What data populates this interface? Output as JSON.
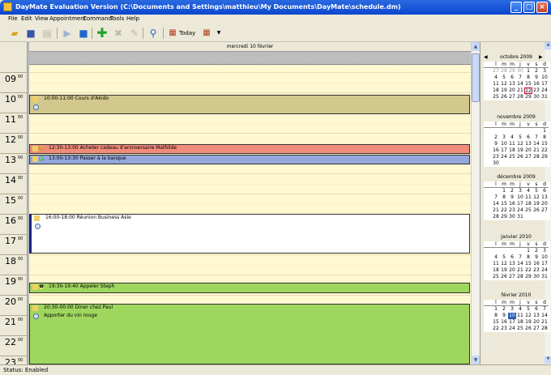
{
  "window": {
    "title": "DayMate Evaluation Version (C:\\Documents and Settings\\matthieu\\My Documents\\DayMate\\schedule.dm)"
  },
  "menu": [
    "File",
    "Edit",
    "View",
    "Appointment",
    "Command",
    "Tools",
    "Help"
  ],
  "toolbar": {
    "today_label": "Today"
  },
  "dayview": {
    "header": "mercredi 10 février",
    "hours": [
      {
        "h": "09",
        "m": "00"
      },
      {
        "h": "10",
        "m": "00"
      },
      {
        "h": "11",
        "m": "00"
      },
      {
        "h": "12",
        "m": "00"
      },
      {
        "h": "13",
        "m": "00"
      },
      {
        "h": "14",
        "m": "00"
      },
      {
        "h": "15",
        "m": "00"
      },
      {
        "h": "16",
        "m": "00"
      },
      {
        "h": "17",
        "m": "00"
      },
      {
        "h": "18",
        "m": "00"
      },
      {
        "h": "19",
        "m": "00"
      },
      {
        "h": "20",
        "m": "00"
      },
      {
        "h": "21",
        "m": "00"
      },
      {
        "h": "22",
        "m": "00"
      },
      {
        "h": "23",
        "m": "00"
      }
    ],
    "appointments": [
      {
        "text": "10:00-11:00 Cours d'Akido",
        "color": "#d2c88e"
      },
      {
        "text": "12:30-13:00 Acheter cadeau d'anniversaire Mathilde",
        "color": "#f28c7a"
      },
      {
        "text": "13:00-13:30 Passer à la banque",
        "color": "#93a6dd"
      },
      {
        "text": "16:00-18:00 Réunion Business Asie",
        "color": "#ffffff"
      },
      {
        "text": "19:30-19:40 Appeler Steph",
        "color": "#9fd65e"
      },
      {
        "text": "20:30-00:00 Diner chez Paul",
        "note": "Apporter du vin rouge",
        "color": "#9fd65e"
      }
    ]
  },
  "calendars": [
    {
      "month": "octobre 2009",
      "days": [
        "l",
        "m",
        "m",
        "j",
        "v",
        "s",
        "d"
      ],
      "weeks": [
        [
          "27",
          "28",
          "29",
          "30",
          "1",
          "2",
          "3"
        ],
        [
          "4",
          "5",
          "6",
          "7",
          "8",
          "9",
          "10"
        ],
        [
          "11",
          "12",
          "13",
          "14",
          "15",
          "16",
          "17"
        ],
        [
          "18",
          "19",
          "20",
          "21",
          "22",
          "23",
          "24"
        ],
        [
          "25",
          "26",
          "27",
          "28",
          "29",
          "30",
          "31"
        ]
      ]
    },
    {
      "month": "novembre 2009",
      "days": [
        "l",
        "m",
        "m",
        "j",
        "v",
        "s",
        "d"
      ],
      "weeks": [
        [
          "",
          "",
          "",
          "",
          "",
          "",
          "1"
        ],
        [
          "2",
          "3",
          "4",
          "5",
          "6",
          "7",
          "8"
        ],
        [
          "9",
          "10",
          "11",
          "12",
          "13",
          "14",
          "15"
        ],
        [
          "16",
          "17",
          "18",
          "19",
          "20",
          "21",
          "22"
        ],
        [
          "23",
          "24",
          "25",
          "26",
          "27",
          "28",
          "29"
        ],
        [
          "30",
          "",
          "",
          "",
          "",
          "",
          ""
        ]
      ]
    },
    {
      "month": "décembre 2009",
      "days": [
        "l",
        "m",
        "m",
        "j",
        "v",
        "s",
        "d"
      ],
      "weeks": [
        [
          "",
          "1",
          "2",
          "3",
          "4",
          "5",
          "6"
        ],
        [
          "7",
          "8",
          "9",
          "10",
          "11",
          "12",
          "13"
        ],
        [
          "14",
          "15",
          "16",
          "17",
          "18",
          "19",
          "20"
        ],
        [
          "21",
          "22",
          "23",
          "24",
          "25",
          "26",
          "27"
        ],
        [
          "28",
          "29",
          "30",
          "31",
          "",
          "",
          ""
        ]
      ]
    },
    {
      "month": "janvier 2010",
      "days": [
        "l",
        "m",
        "m",
        "j",
        "v",
        "s",
        "d"
      ],
      "weeks": [
        [
          "",
          "",
          "",
          "",
          "1",
          "2",
          "3"
        ],
        [
          "4",
          "5",
          "6",
          "7",
          "8",
          "9",
          "10"
        ],
        [
          "11",
          "12",
          "13",
          "14",
          "15",
          "16",
          "17"
        ],
        [
          "18",
          "19",
          "20",
          "21",
          "22",
          "23",
          "24"
        ],
        [
          "25",
          "26",
          "27",
          "28",
          "29",
          "30",
          "31"
        ]
      ]
    },
    {
      "month": "février 2010",
      "days": [
        "l",
        "m",
        "m",
        "j",
        "v",
        "s",
        "d"
      ],
      "weeks": [
        [
          "1",
          "2",
          "3",
          "4",
          "5",
          "6",
          "7"
        ],
        [
          "8",
          "9",
          "10",
          "11",
          "12",
          "13",
          "14"
        ],
        [
          "15",
          "16",
          "17",
          "18",
          "19",
          "20",
          "21"
        ],
        [
          "22",
          "23",
          "24",
          "25",
          "26",
          "27",
          "28"
        ]
      ]
    }
  ],
  "status": "Status: Enabled"
}
